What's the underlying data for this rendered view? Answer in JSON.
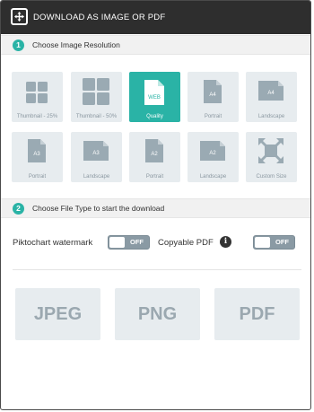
{
  "header": {
    "title": "DOWNLOAD AS IMAGE OR PDF",
    "icon": "expand-frame-icon"
  },
  "step1": {
    "number": "1",
    "label": "Choose Image Resolution"
  },
  "tiles": [
    {
      "label": "Thumbnail - 25%",
      "icon": "grid-small-icon",
      "badge": ""
    },
    {
      "label": "Thumbnail - 50%",
      "icon": "grid-large-icon",
      "badge": ""
    },
    {
      "label": "Quality",
      "icon": "web-document-icon",
      "badge": "WEB"
    },
    {
      "label": "Portrait",
      "icon": "portrait-page-icon",
      "badge": "A4"
    },
    {
      "label": "Landscape",
      "icon": "landscape-page-icon",
      "badge": "A4"
    },
    {
      "label": "Portrait",
      "icon": "portrait-page-icon",
      "badge": "A3"
    },
    {
      "label": "Landscape",
      "icon": "landscape-page-icon",
      "badge": "A3"
    },
    {
      "label": "Portrait",
      "icon": "portrait-page-icon",
      "badge": "A2"
    },
    {
      "label": "Landscape",
      "icon": "landscape-page-icon",
      "badge": "A2"
    },
    {
      "label": "Custom Size",
      "icon": "custom-size-icon",
      "badge": ""
    }
  ],
  "selected_tile": "Quality",
  "step2": {
    "number": "2",
    "label": "Choose File Type to start the download"
  },
  "options": {
    "watermark_label": "Piktochart watermark",
    "watermark_state": "OFF",
    "copyable_label": "Copyable PDF",
    "copyable_state": "OFF",
    "info_glyph": "i"
  },
  "formats": [
    "JPEG",
    "PNG",
    "PDF"
  ],
  "colors": {
    "accent": "#2ab3a6",
    "header": "#2e2e2e",
    "tile": "#e7ecef",
    "muted": "#8b98a1"
  }
}
